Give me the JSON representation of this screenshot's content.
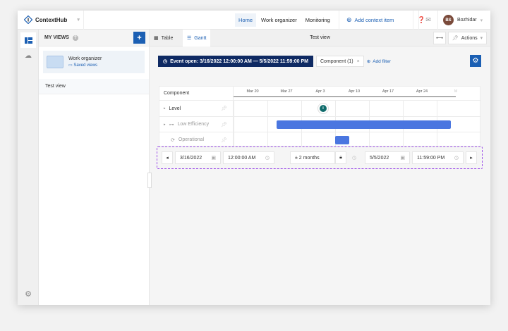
{
  "app": {
    "name": "ContextHub"
  },
  "nav": {
    "items": [
      "Home",
      "Work organizer",
      "Monitoring"
    ],
    "active": "Home",
    "add_context": "Add context item",
    "user_initials": "BS",
    "user_name": "Bozhidar"
  },
  "sidebar": {
    "title": "MY VIEWS",
    "organizer": {
      "title": "Work organizer",
      "subtitle": "Saved views"
    },
    "views": [
      "Test view"
    ]
  },
  "toolbar": {
    "tabs": [
      "Table",
      "Gantt"
    ],
    "active_tab": "Gantt",
    "view_title": "Test view",
    "actions_label": "Actions"
  },
  "filters": {
    "event": "Event open: 3/16/2022 12:00:00 AM — 5/5/2022 11:59:00 PM",
    "component_chip": "Component (1)",
    "add_filter": "Add filter"
  },
  "gantt": {
    "column_header": "Component",
    "ticks": [
      "Mar 20",
      "Mar 27",
      "Apr 3",
      "Apr 10",
      "Apr 17",
      "Apr 24",
      "M"
    ],
    "rows": [
      {
        "label": "Level",
        "icon": "",
        "event_marker": "2022-04-03",
        "muted": false
      },
      {
        "label": "Low Efficiency",
        "icon": "link-icon",
        "bar_start": "2022-03-25",
        "bar_end": "2022-04-30",
        "muted": true
      },
      {
        "label": "Operational",
        "icon": "refresh-icon",
        "bar_start": "2022-04-06",
        "bar_end": "2022-04-09",
        "muted": true
      }
    ],
    "bar_color": "#4a76e0"
  },
  "time_controls": {
    "start_date": "3/16/2022",
    "start_time": "12:00:00 AM",
    "range": "± 2 months",
    "end_date": "5/5/2022",
    "end_time": "11:59:00 PM"
  },
  "colors": {
    "accent": "#1b5fb3",
    "event_chip": "#0f2a63",
    "highlight": "#9b4de8"
  }
}
